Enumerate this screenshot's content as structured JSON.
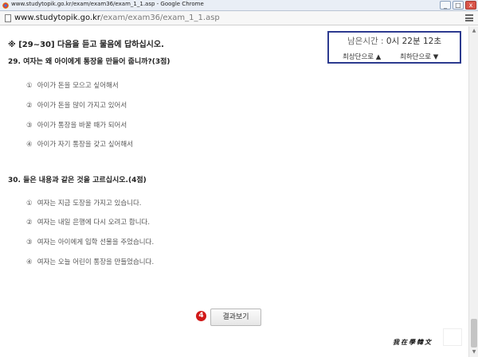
{
  "window": {
    "title": "www.studytopik.go.kr/exam/exam36/exam_1_1.asp - Google Chrome",
    "buttons": [
      "_",
      "□",
      "x"
    ]
  },
  "address": {
    "host": "www.studytopik.go.kr",
    "path": "/exam/exam36/exam_1_1.asp"
  },
  "instruction": "※ [29~30] 다음을 듣고 물음에 답하십시오.",
  "questions": [
    {
      "title": "29. 여자는 왜 아이에게 통장을 만들어 줍니까?(3점)",
      "options": [
        {
          "num": "①",
          "text": "아이가 돈을 모으고 싶어해서"
        },
        {
          "num": "②",
          "text": "아이가 돈을 많이 가지고 있어서"
        },
        {
          "num": "③",
          "text": "아이가 통장을 바꿀 때가 되어서"
        },
        {
          "num": "④",
          "text": "아이가 자기 통장을 갖고 싶어해서"
        }
      ]
    },
    {
      "title": "30. 들은 내용과 같은 것을 고르십시오.(4점)",
      "options": [
        {
          "num": "①",
          "text": "여자는 지금 도장을 가지고 있습니다."
        },
        {
          "num": "②",
          "text": "여자는 내일 은행에 다시 오려고 합니다."
        },
        {
          "num": "③",
          "text": "여자는 아이에게 입학 선물을 주었습니다."
        },
        {
          "num": "④",
          "text": "여자는 오늘 어린이 통장을 만들었습니다."
        }
      ]
    }
  ],
  "timer": {
    "label": "남은시간 :",
    "hours": "0",
    "hours_unit": "시",
    "minutes": "22",
    "minutes_unit": "분",
    "seconds": "12",
    "seconds_unit": "초",
    "scroll_top": "최상단으로 ▲",
    "scroll_bottom": "최하단으로 ▼"
  },
  "result": {
    "badge": "4",
    "button_label": "결과보기"
  },
  "watermark": "我在學韓文",
  "icons": [
    "chrome-icon",
    "page-icon",
    "menu-icon",
    "minimize-icon",
    "maximize-icon",
    "close-icon",
    "scroll-up-icon",
    "scroll-down-icon"
  ]
}
